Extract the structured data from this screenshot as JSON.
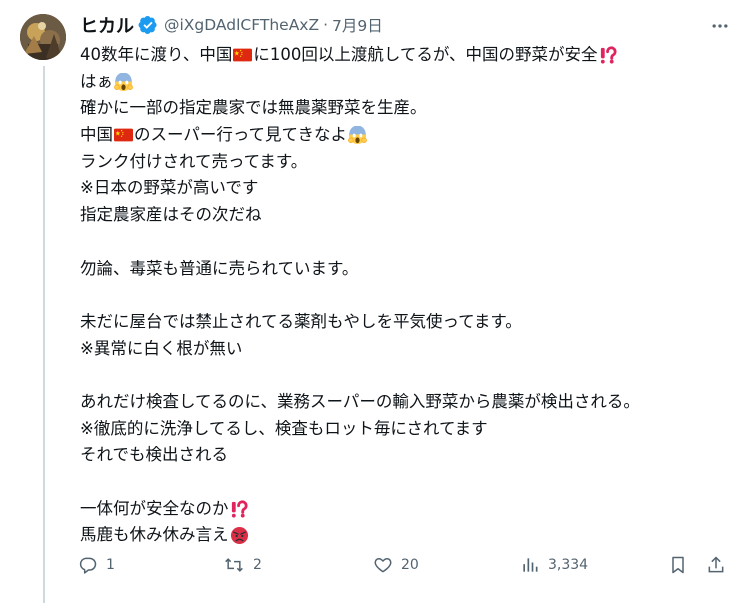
{
  "tweet": {
    "author": {
      "display_name": "ヒカル",
      "verified": true,
      "verified_icon": "verified-badge-icon",
      "handle": "@iXgDAdlCFTheAxZ",
      "separator": "·",
      "date": "7月9日"
    },
    "body": {
      "l1a": "40数年に渡り、中国",
      "l1b": "に100回以上渡航してるが、中国の野菜が安全",
      "l2": "はぁ",
      "l3": "確かに一部の指定農家では無農薬野菜を生産。",
      "l4a": "中国",
      "l4b": "のスーパー行って見てきなよ",
      "l5": "ランク付けされて売ってます。",
      "l6": "※日本の野菜が高いです",
      "l7": "指定農家産はその次だね",
      "l8": "勿論、毒菜も普通に売られています。",
      "l9": "未だに屋台では禁止されてる薬剤もやしを平気使ってます。",
      "l10": "※異常に白く根が無い",
      "l11": "あれだけ検査してるのに、業務スーパーの輸入野菜から農薬が検出される。",
      "l12": "※徹底的に洗浄してるし、検査もロット毎にされてます",
      "l13": "それでも検出される",
      "l14": "一体何が安全なのか",
      "l15": "馬鹿も休み休み言え"
    },
    "emojis": {
      "flag": "china-flag-icon",
      "interrobang": "interrobang-icon",
      "scream": "scream-face-icon",
      "angry": "angry-face-icon"
    },
    "actions": {
      "reply_count": "1",
      "retweet_count": "2",
      "like_count": "20",
      "views_count": "3,334"
    },
    "colors": {
      "text": "#0f1419",
      "secondary": "#536471",
      "verified": "#1d9bf0",
      "thread_line": "#cfd9de"
    }
  }
}
